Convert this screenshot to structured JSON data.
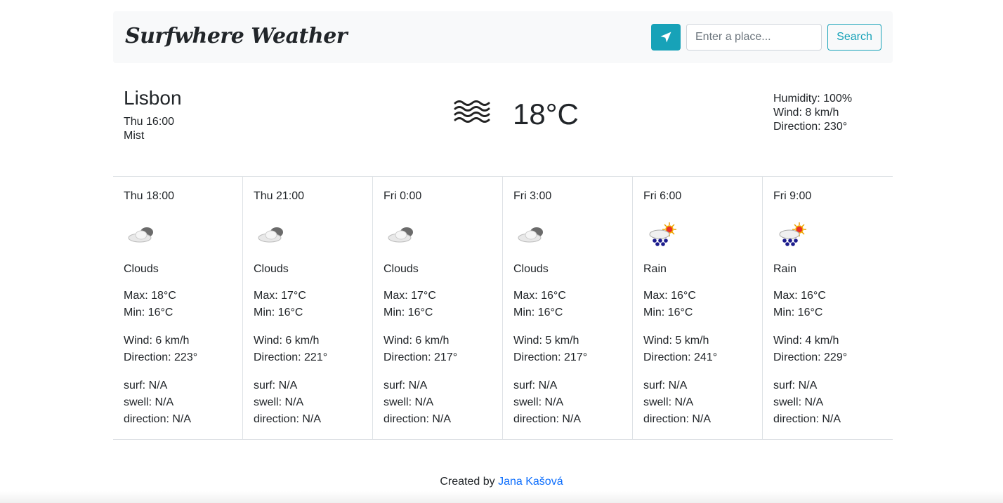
{
  "header": {
    "brand": "Surfwhere Weather",
    "search_placeholder": "Enter a place...",
    "search_label": "Search",
    "locate_icon": "location-arrow-icon",
    "accent_color": "#17a2b8"
  },
  "current": {
    "city": "Lisbon",
    "datetime": "Thu 16:00",
    "description": "Mist",
    "icon": "mist-icon",
    "temperature": "18°C",
    "humidity": "Humidity: 100%",
    "wind": "Wind: 8 km/h",
    "direction": "Direction: 230°"
  },
  "forecast": [
    {
      "time": "Thu 18:00",
      "icon": "cloud-icon",
      "condition": "Clouds",
      "max": "Max: 18°C",
      "min": "Min: 16°C",
      "wind": "Wind: 6 km/h",
      "direction": "Direction: 223°",
      "surf": "surf: N/A",
      "swell": "swell: N/A",
      "swell_direction": "direction: N/A"
    },
    {
      "time": "Thu 21:00",
      "icon": "cloud-icon",
      "condition": "Clouds",
      "max": "Max: 17°C",
      "min": "Min: 16°C",
      "wind": "Wind: 6 km/h",
      "direction": "Direction: 221°",
      "surf": "surf: N/A",
      "swell": "swell: N/A",
      "swell_direction": "direction: N/A"
    },
    {
      "time": "Fri 0:00",
      "icon": "cloud-icon",
      "condition": "Clouds",
      "max": "Max: 17°C",
      "min": "Min: 16°C",
      "wind": "Wind: 6 km/h",
      "direction": "Direction: 217°",
      "surf": "surf: N/A",
      "swell": "swell: N/A",
      "swell_direction": "direction: N/A"
    },
    {
      "time": "Fri 3:00",
      "icon": "cloud-icon",
      "condition": "Clouds",
      "max": "Max: 16°C",
      "min": "Min: 16°C",
      "wind": "Wind: 5 km/h",
      "direction": "Direction: 217°",
      "surf": "surf: N/A",
      "swell": "swell: N/A",
      "swell_direction": "direction: N/A"
    },
    {
      "time": "Fri 6:00",
      "icon": "sun-rain-icon",
      "condition": "Rain",
      "max": "Max: 16°C",
      "min": "Min: 16°C",
      "wind": "Wind: 5 km/h",
      "direction": "Direction: 241°",
      "surf": "surf: N/A",
      "swell": "swell: N/A",
      "swell_direction": "direction: N/A"
    },
    {
      "time": "Fri 9:00",
      "icon": "sun-rain-icon",
      "condition": "Rain",
      "max": "Max: 16°C",
      "min": "Min: 16°C",
      "wind": "Wind: 4 km/h",
      "direction": "Direction: 229°",
      "surf": "surf: N/A",
      "swell": "swell: N/A",
      "swell_direction": "direction: N/A"
    }
  ],
  "footer": {
    "prefix": "Created by",
    "author": "Jana Kašová"
  }
}
